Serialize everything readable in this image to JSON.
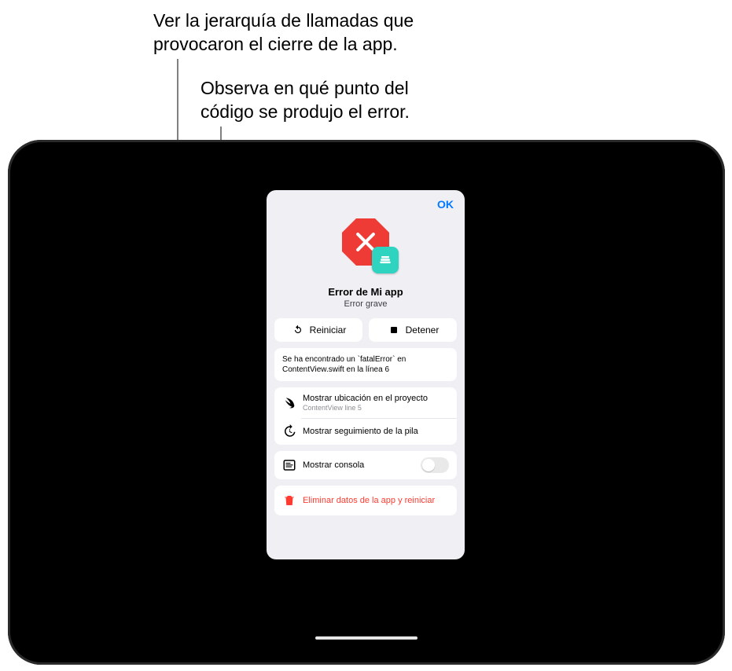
{
  "callouts": {
    "stack": "Ver la jerarquía de llamadas que\nprovocaron el cierre de la app.",
    "location": "Observa en qué punto del\ncódigo se produjo el error."
  },
  "dialog": {
    "ok": "OK",
    "title": "Error de Mi app",
    "subtitle": "Error grave",
    "restart": "Reiniciar",
    "stop": "Detener",
    "message": "Se ha encontrado un `fatalError` en ContentView.swift en la línea 6",
    "show_location": "Mostrar ubicación en el proyecto",
    "show_location_sub": "ContentView line 5",
    "show_stack": "Mostrar seguimiento de la pila",
    "show_console": "Mostrar consola",
    "console_on": false,
    "delete_restart": "Eliminar datos de la app y reiniciar"
  }
}
